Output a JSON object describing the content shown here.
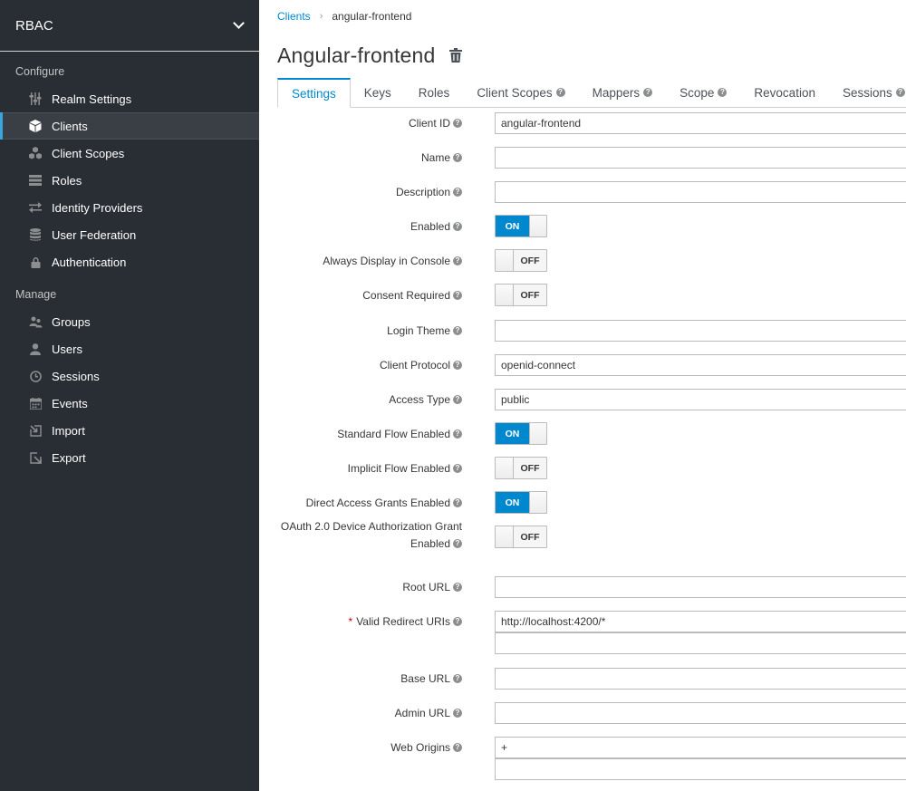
{
  "sidebar": {
    "realm": "RBAC",
    "configure_label": "Configure",
    "manage_label": "Manage",
    "configure_items": [
      {
        "label": "Realm Settings",
        "icon": "sliders-icon"
      },
      {
        "label": "Clients",
        "icon": "cube-icon",
        "active": true
      },
      {
        "label": "Client Scopes",
        "icon": "cubes-icon"
      },
      {
        "label": "Roles",
        "icon": "roles-icon"
      },
      {
        "label": "Identity Providers",
        "icon": "exchange-icon"
      },
      {
        "label": "User Federation",
        "icon": "database-icon"
      },
      {
        "label": "Authentication",
        "icon": "lock-icon"
      }
    ],
    "manage_items": [
      {
        "label": "Groups",
        "icon": "groups-icon"
      },
      {
        "label": "Users",
        "icon": "user-icon"
      },
      {
        "label": "Sessions",
        "icon": "clock-icon"
      },
      {
        "label": "Events",
        "icon": "calendar-icon"
      },
      {
        "label": "Import",
        "icon": "import-icon"
      },
      {
        "label": "Export",
        "icon": "export-icon"
      }
    ]
  },
  "breadcrumb": {
    "parent": "Clients",
    "current": "angular-frontend"
  },
  "page_title": "Angular-frontend",
  "tabs": [
    {
      "label": "Settings",
      "active": true,
      "help": false
    },
    {
      "label": "Keys",
      "help": false
    },
    {
      "label": "Roles",
      "help": false
    },
    {
      "label": "Client Scopes",
      "help": true
    },
    {
      "label": "Mappers",
      "help": true
    },
    {
      "label": "Scope",
      "help": true
    },
    {
      "label": "Revocation",
      "help": false
    },
    {
      "label": "Sessions",
      "help": true
    }
  ],
  "form": {
    "client_id": {
      "label": "Client ID",
      "value": "angular-frontend"
    },
    "name": {
      "label": "Name",
      "value": ""
    },
    "description": {
      "label": "Description",
      "value": ""
    },
    "enabled": {
      "label": "Enabled",
      "state": "ON"
    },
    "always_display": {
      "label": "Always Display in Console",
      "state": "OFF"
    },
    "consent_required": {
      "label": "Consent Required",
      "state": "OFF"
    },
    "login_theme": {
      "label": "Login Theme",
      "value": ""
    },
    "client_protocol": {
      "label": "Client Protocol",
      "value": "openid-connect"
    },
    "access_type": {
      "label": "Access Type",
      "value": "public"
    },
    "standard_flow": {
      "label": "Standard Flow Enabled",
      "state": "ON"
    },
    "implicit_flow": {
      "label": "Implicit Flow Enabled",
      "state": "OFF"
    },
    "direct_access": {
      "label": "Direct Access Grants Enabled",
      "state": "ON"
    },
    "device_grant": {
      "label": "OAuth 2.0 Device Authorization Grant Enabled",
      "state": "OFF"
    },
    "root_url": {
      "label": "Root URL",
      "value": ""
    },
    "redirect_uris": {
      "label": "Valid Redirect URIs",
      "required": "*",
      "values": [
        "http://localhost:4200/*",
        ""
      ]
    },
    "base_url": {
      "label": "Base URL",
      "value": ""
    },
    "admin_url": {
      "label": "Admin URL",
      "value": ""
    },
    "web_origins": {
      "label": "Web Origins",
      "values": [
        "+",
        ""
      ]
    }
  },
  "colors": {
    "accent": "#0088ce",
    "sidebar": "#292e34",
    "active_bar": "#39a5dc"
  }
}
